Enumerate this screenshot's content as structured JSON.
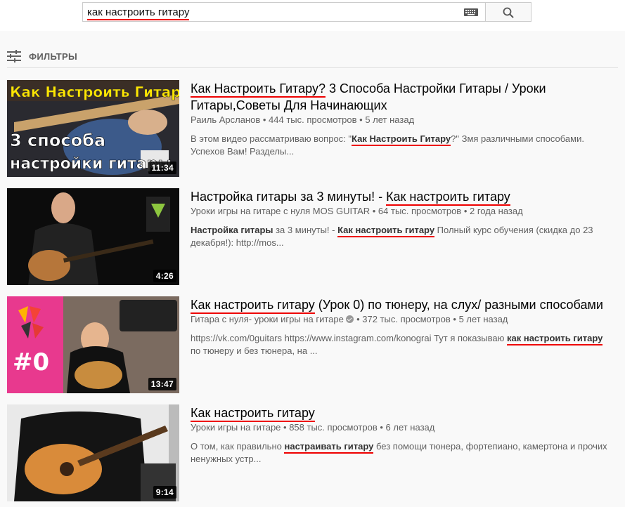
{
  "search": {
    "query": "как настроить гитару"
  },
  "filters": {
    "label": "ФИЛЬТРЫ"
  },
  "results": [
    {
      "title_hl": "Как Настроить Гитару?",
      "title_rest": " 3 Способа Настройки Гитары / Уроки Гитары,Советы Для Начинающих",
      "channel": "Раиль Арсланов",
      "views": "444 тыс. просмотров",
      "age": "5 лет назад",
      "desc_pre": "В этом видео рассматриваю вопрос: \"",
      "desc_hl": "Как Настроить Гитару",
      "desc_post": "?\" Змя различными способами. Успехов Вам! Разделы...",
      "duration": "11:34",
      "thumb_text_top": "Как Настроить Гитару?",
      "thumb_text_bottom_1": "3 способа",
      "thumb_text_bottom_2": "настройки гитары"
    },
    {
      "title_pre": "Настройка гитары за 3 минуты! - ",
      "title_hl": "Как настроить гитару",
      "channel": "Уроки игры на гитаре с нуля MOS GUITAR",
      "views": "64 тыс. просмотров",
      "age": "2 года назад",
      "desc_b1": "Настройка гитары",
      "desc_mid": " за 3 минуты! - ",
      "desc_hl": "Как настроить гитару",
      "desc_post": " Полный курс обучения (скидка до 23 декабря!): http://mos...",
      "duration": "4:26"
    },
    {
      "title_hl": "Как настроить гитару",
      "title_rest": " (Урок 0) по тюнеру, на слух/ разными способами",
      "channel": "Гитара с нуля- уроки игры на гитаре",
      "views": "372 тыс. просмотров",
      "age": "5 лет назад",
      "desc_pre": "https://vk.com/0guitars https://www.instagram.com/konograi Тут я показываю ",
      "desc_hl": "как настроить гитару",
      "desc_post": " по тюнеру и без тюнера, на ...",
      "duration": "13:47",
      "thumb_badge": "#0"
    },
    {
      "title_hl": "Как настроить гитару",
      "channel": "Уроки игры на гитаре",
      "views": "858 тыс. просмотров",
      "age": "6 лет назад",
      "desc_pre": "О том, как правильно ",
      "desc_hl": "настраивать гитару",
      "desc_post": " без помощи тюнера, фортепиано, камертона и прочих ненужных устр...",
      "duration": "9:14"
    }
  ],
  "separator": " • ",
  "colors": {
    "underline": "#e00000",
    "thumb_title": "#ffe600",
    "badge_pink": "#e8398e"
  }
}
